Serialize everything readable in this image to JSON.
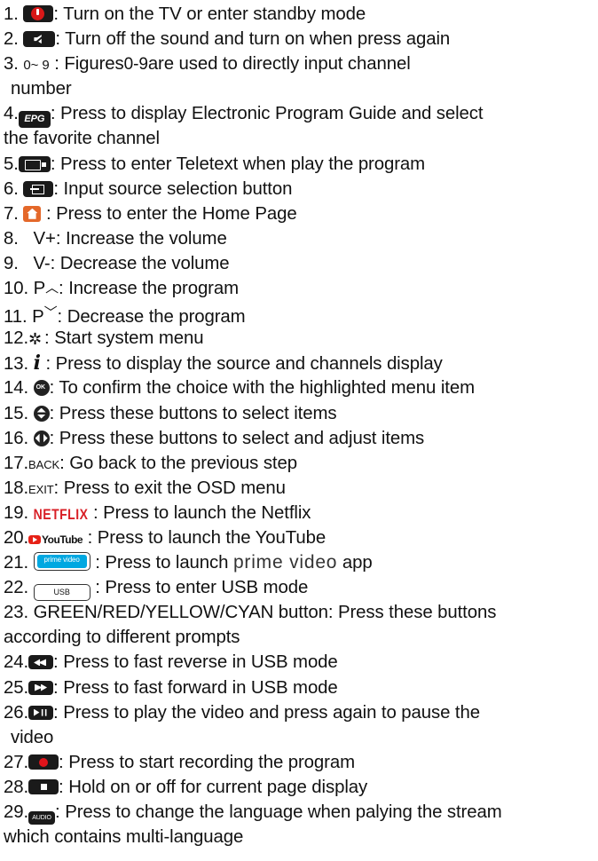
{
  "items": [
    {
      "num": "1.",
      "icon": "power-icon",
      "sep": ": ",
      "text": "Turn on the TV or enter standby mode"
    },
    {
      "num": "2.",
      "icon": "mute-icon",
      "sep": ": ",
      "text": "Turn off the sound and turn on when press again"
    },
    {
      "num": "3.",
      "key_a": "0",
      "key_sep": "~",
      "key_b": "9",
      "sep": " : ",
      "text_a": "Figures",
      "text_b": "0-9",
      "text_c": "are used to directly input channel",
      "cont": "number"
    },
    {
      "num": "4.",
      "icon": "epg-icon",
      "icon_label": "EPG",
      "sep": ": ",
      "text": "Press to display Electronic Program Guide and select",
      "cont": "the favorite channel"
    },
    {
      "num": "5.",
      "icon": "teletext-icon",
      "sep": ": ",
      "text": "Press to enter Teletext when play the program"
    },
    {
      "num": "6.",
      "icon": "input-source-icon",
      "sep": ": ",
      "text": "Input source selection button"
    },
    {
      "num": "7.",
      "icon": "home-icon",
      "sep": " : ",
      "text": "Press to enter the Home Page"
    },
    {
      "num": "8.",
      "key": "V+",
      "sep": ": ",
      "text": "Increase the volume"
    },
    {
      "num": "9.",
      "key": "V-",
      "sep": ": ",
      "text": "Decrease the volume"
    },
    {
      "num": "10.",
      "key": "P",
      "caret": "︿",
      "sep": ": ",
      "text": "Increase the program"
    },
    {
      "num": "11.",
      "key": "P",
      "caret": "﹀",
      "sep": ": ",
      "text": "Decrease the program"
    },
    {
      "num": "12.",
      "icon": "gear-icon",
      "glyph": "✲",
      "sep": ": ",
      "text": "Start system menu"
    },
    {
      "num": "13.",
      "icon": "info-icon",
      "glyph": "i",
      "sep": " : ",
      "text": "Press to display the source and channels display"
    },
    {
      "num": "14.",
      "icon": "ok-icon",
      "sep": ": ",
      "text": "To confirm the choice with the highlighted menu item"
    },
    {
      "num": "15.",
      "icon": "up-down-icon",
      "sep": ": ",
      "text": "Press these buttons to select items"
    },
    {
      "num": "16.",
      "icon": "left-right-icon",
      "sep": ": ",
      "text": "Press these buttons to select and adjust items"
    },
    {
      "num": "17.",
      "key": "BACK",
      "sep": ": ",
      "text": "Go back to the previous step"
    },
    {
      "num": "18.",
      "key": "EXIT",
      "sep": ": ",
      "text": "Press to exit the OSD menu"
    },
    {
      "num": "19.",
      "icon": "netflix-icon",
      "icon_label": "NETFLIX",
      "sep": " : ",
      "text": "Press to launch the Netflix"
    },
    {
      "num": "20.",
      "icon": "youtube-icon",
      "icon_label": "YouTube",
      "sep": " : ",
      "text": "Press to launch the YouTube"
    },
    {
      "num": "21.",
      "icon": "prime-video-icon",
      "icon_label": "prime video",
      "sep": " : ",
      "text_a": "Press to launch ",
      "text_b": "prime video",
      "text_c": " app"
    },
    {
      "num": "22.",
      "icon": "usb-icon",
      "icon_label": "USB",
      "sep": " : ",
      "text": "Press to enter USB mode"
    },
    {
      "num": "23.",
      "text": "GREEN/RED/YELLOW/CYAN button: Press these buttons",
      "cont": "according to different prompts"
    },
    {
      "num": "24.",
      "icon": "fast-reverse-icon",
      "sep": ": ",
      "text": "Press to fast reverse in USB mode"
    },
    {
      "num": "25.",
      "icon": "fast-forward-icon",
      "sep": ": ",
      "text": "Press to fast forward in USB mode"
    },
    {
      "num": "26.",
      "icon": "play-pause-icon",
      "sep": ": ",
      "text": "Press to play the video and press again to pause the",
      "cont": "video"
    },
    {
      "num": "27.",
      "icon": "record-icon",
      "sep": ": ",
      "text": "Press to start recording the program"
    },
    {
      "num": "28.",
      "icon": "stop-icon",
      "sep": ": ",
      "text": "Hold on or off for current page display"
    },
    {
      "num": "29.",
      "icon": "audio-icon",
      "icon_label": "AUDIO",
      "sep": ": ",
      "text": "Press to change the language when palying the stream",
      "cont": "which contains multi-language"
    }
  ]
}
